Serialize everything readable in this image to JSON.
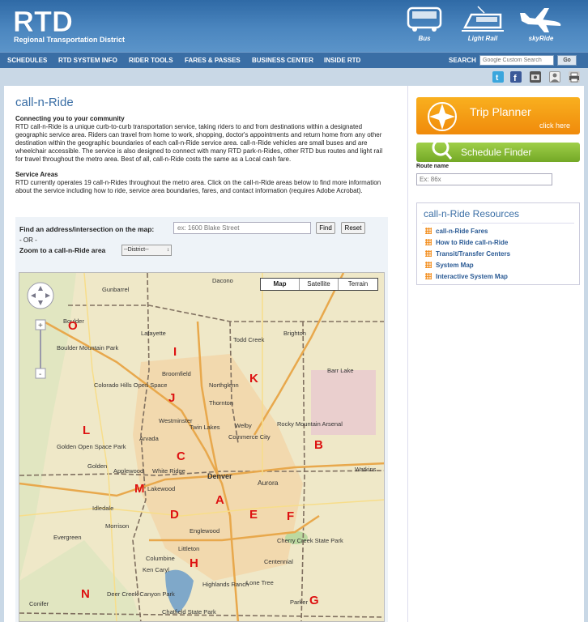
{
  "header": {
    "logo_text": "RTD",
    "subtitle": "Regional Transportation District",
    "modes": [
      {
        "label": "Bus",
        "icon": "bus-icon"
      },
      {
        "label": "Light Rail",
        "icon": "light-rail-icon"
      },
      {
        "label": "skyRide",
        "icon": "airplane-icon"
      }
    ]
  },
  "nav": {
    "items": [
      "SCHEDULES",
      "RTD SYSTEM INFO",
      "RIDER TOOLS",
      "FARES & PASSES",
      "BUSINESS CENTER",
      "INSIDE RTD"
    ],
    "search_label": "SEARCH",
    "search_placeholder": "Google Custom Search",
    "search_button": "Go"
  },
  "toolbar_icons": [
    "twitter-icon",
    "facebook-icon",
    "video-icon",
    "user-icon",
    "print-icon"
  ],
  "page": {
    "title": "call-n-Ride",
    "intro_heading": "Connecting you to your community",
    "intro_text": "RTD call-n-Ride is a unique curb-to-curb transportation service, taking riders to and from destinations within a designated geographic service area. Riders can travel from home to work, shopping, doctor's appointments and return home from any other destination within the geographic boundaries of each call-n-Ride service area. call-n-Ride vehicles are small buses and are wheelchair accessible. The service is also designed to connect with many RTD park-n-Rides, other RTD bus routes and light rail for travel throughout the metro area. Best of all, call-n-Ride costs the same as a Local cash fare.",
    "areas_heading": "Service Areas",
    "areas_text": "RTD currently operates 19 call-n-Rides throughout the metro area. Click on the call-n-Ride areas below to find more information about the service including how to ride, service area boundaries, fares, and contact information (requires Adobe Acrobat)."
  },
  "map_panel": {
    "find_label": "Find an address/intersection on the map:",
    "find_placeholder": "ex: 1600 Blake Street",
    "find_button": "Find",
    "reset_button": "Reset",
    "or_text": "- OR -",
    "zoom_label": "Zoom to a  call-n-Ride area",
    "district_select": "--District--",
    "map_types": [
      "Map",
      "Satellite",
      "Terrain"
    ],
    "active_map_type": "Map",
    "districts": [
      "O",
      "I",
      "K",
      "J",
      "L",
      "B",
      "C",
      "M",
      "A",
      "E",
      "F",
      "D",
      "H",
      "N",
      "G"
    ],
    "towns": [
      "Dacono",
      "Gunbarrel",
      "Boulder",
      "Boulder Mountain Park",
      "Lafayette",
      "Todd Creek",
      "Brighton",
      "Broomfield",
      "Northglenn",
      "Barr Lake",
      "Thornton",
      "Westminster",
      "Twin Lakes",
      "Welby",
      "Rocky Mountain Arsenal",
      "Arvada",
      "Commerce City",
      "White Ridge",
      "Golden",
      "Applewood",
      "Denver",
      "Aurora",
      "Watkins",
      "Lakewood",
      "Englewood",
      "Littleton",
      "Centennial",
      "Columbine",
      "Ken Caryl",
      "Highlands Ranch",
      "Parker",
      "Evergreen",
      "Morrison",
      "Conifer",
      "Deer Creek Canyon Park",
      "Lone Tree",
      "Cherry Creek State Park",
      "Colorado Hills Open Space",
      "Golden Open Space Park",
      "Idledale",
      "Chatfield State Park"
    ]
  },
  "sidebar": {
    "trip_planner_title": "Trip Planner",
    "trip_planner_link": "click here",
    "schedule_finder_title": "Schedule Finder",
    "route_label": "Route name",
    "route_placeholder": "Ex: 86x",
    "resources_title": "call-n-Ride Resources",
    "resources": [
      "call-n-Ride Fares",
      "How to Ride call-n-Ride",
      "Transit/Transfer Centers",
      "System Map",
      "Interactive System Map"
    ]
  },
  "colors": {
    "brand_blue": "#3a6ea5",
    "district_red": "#d11111",
    "trip_orange": "#f08a0b",
    "schedule_green": "#73a826"
  }
}
